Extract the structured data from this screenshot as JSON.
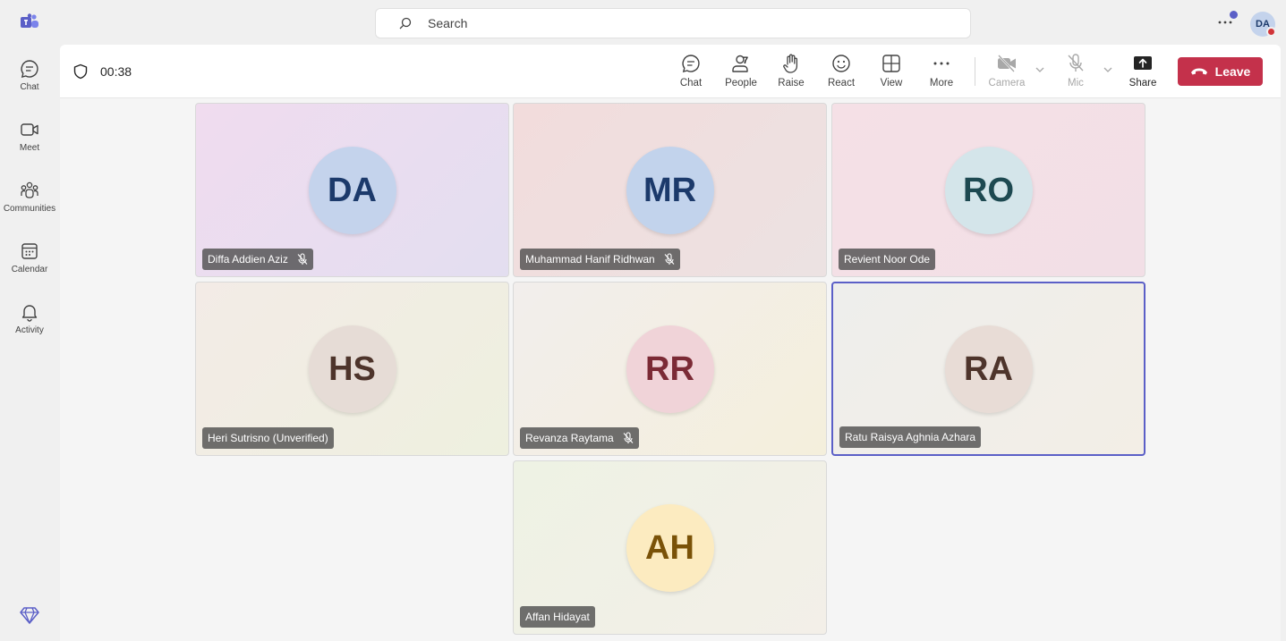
{
  "search": {
    "placeholder": "Search"
  },
  "user": {
    "initials": "DA"
  },
  "rail": [
    {
      "label": "Chat",
      "icon": "chat-icon"
    },
    {
      "label": "Meet",
      "icon": "video-icon"
    },
    {
      "label": "Communities",
      "icon": "communities-icon"
    },
    {
      "label": "Calendar",
      "icon": "calendar-icon"
    },
    {
      "label": "Activity",
      "icon": "bell-icon"
    }
  ],
  "meeting": {
    "timer": "00:38",
    "people_count": "7",
    "toolbar": {
      "chat": "Chat",
      "people": "People",
      "raise": "Raise",
      "react": "React",
      "view": "View",
      "more": "More",
      "camera": "Camera",
      "mic": "Mic",
      "share": "Share",
      "leave": "Leave"
    },
    "participants": [
      {
        "initials": "DA",
        "name": "Diffa Addien Aziz",
        "muted": true,
        "circle_bg": "#c4d3ec",
        "circle_fg": "#1c3a6b",
        "tile_bg": "linear-gradient(135deg,#f0dcef,#e3def0)"
      },
      {
        "initials": "MR",
        "name": "Muhammad Hanif Ridhwan",
        "muted": true,
        "circle_bg": "#c2d3ec",
        "circle_fg": "#1c3a6b",
        "tile_bg": "linear-gradient(135deg,#f2dcdc,#ece2e2)"
      },
      {
        "initials": "RO",
        "name": "Revient Noor Ode",
        "muted": false,
        "circle_bg": "#d4e5ea",
        "circle_fg": "#1d4951",
        "tile_bg": "linear-gradient(135deg,#f5e0e6,#f2dfe6)"
      },
      {
        "initials": "HS",
        "name": "Heri Sutrisno (Unverified)",
        "muted": false,
        "circle_bg": "#e6dcd6",
        "circle_fg": "#4e342b",
        "tile_bg": "linear-gradient(135deg,#f3ebe6,#eef0df)"
      },
      {
        "initials": "RR",
        "name": "Revanza Raytama",
        "muted": true,
        "circle_bg": "#f0d3d8",
        "circle_fg": "#7b2a35",
        "tile_bg": "linear-gradient(135deg,#f2eeec,#f4efdc)"
      },
      {
        "initials": "RA",
        "name": "Ratu Raisya Aghnia Azhara",
        "muted": false,
        "circle_bg": "#e8dcd6",
        "circle_fg": "#4e342b",
        "tile_bg": "linear-gradient(135deg,#eeeeec,#f3eee6)"
      },
      {
        "initials": "AH",
        "name": "Affan Hidayat",
        "muted": false,
        "circle_bg": "#fcebc0",
        "circle_fg": "#7a5208",
        "tile_bg": "linear-gradient(135deg,#eef2e4,#f3efe8)"
      }
    ]
  }
}
